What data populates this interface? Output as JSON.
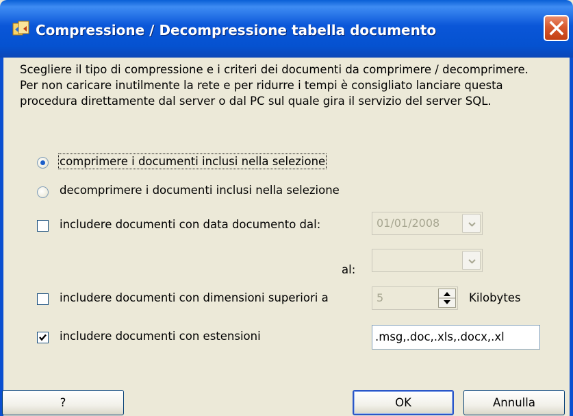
{
  "window": {
    "title": "Compressione / Decompressione tabella documento",
    "icons": {
      "app": "app-icon",
      "close": "close-icon"
    }
  },
  "description": "Scegliere il tipo di compressione e i criteri dei documenti da comprimere / decomprimere. Per non caricare inutilmente la rete e per ridurre i tempi è consigliato lanciare questa procedura direttamente dal server o dal PC sul quale gira il servizio del server SQL.",
  "options": {
    "compress_label": "comprimere i documenti inclusi nella selezione",
    "compress_selected": true,
    "decompress_label": "decomprimere i documenti inclusi nella selezione",
    "decompress_selected": false,
    "date_filter": {
      "label": "includere documenti con data documento dal:",
      "checked": false,
      "from_value": "01/01/2008",
      "to_label": "al:",
      "to_value": ""
    },
    "size_filter": {
      "label": "includere documenti con dimensioni superiori a",
      "checked": false,
      "value": "5",
      "unit": "Kilobytes"
    },
    "extension_filter": {
      "label": "includere documenti con estensioni",
      "checked": true,
      "value": ".msg,.doc,.xls,.docx,.xl"
    }
  },
  "buttons": {
    "help": "?",
    "ok": "OK",
    "cancel": "Annulla"
  },
  "colors": {
    "titlebar": "#0a56d8",
    "dialog_bg": "#ece9d8",
    "close": "#d8582e"
  }
}
